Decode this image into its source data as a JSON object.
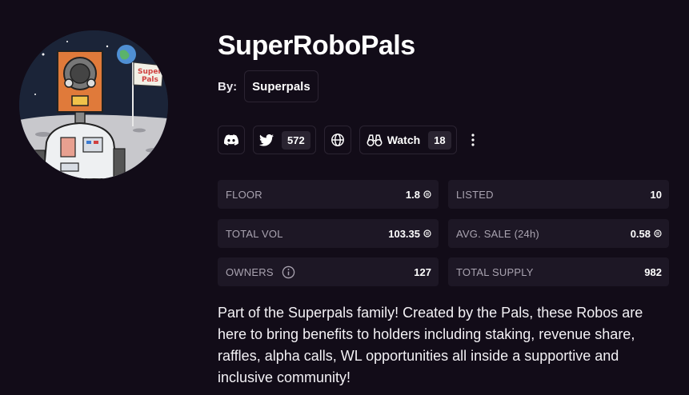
{
  "collection": {
    "name": "SuperRoboPals",
    "by_label": "By:",
    "creator": "Superpals",
    "avatar_flag_text": "Super Pals"
  },
  "social": {
    "discord_icon": "discord-icon",
    "twitter_icon": "twitter-icon",
    "twitter_count": "572",
    "website_icon": "globe-icon",
    "watch_icon": "binoculars-icon",
    "watch_label": "Watch",
    "watch_count": "18",
    "more_icon": "kebab-menu-icon"
  },
  "stats": {
    "floor": {
      "label": "FLOOR",
      "value": "1.8"
    },
    "listed": {
      "label": "LISTED",
      "value": "10"
    },
    "total_vol": {
      "label": "TOTAL VOL",
      "value": "103.35"
    },
    "avg_sale": {
      "label": "AVG. SALE (24h)",
      "value": "0.58"
    },
    "owners": {
      "label": "OWNERS",
      "value": "127"
    },
    "total_supply": {
      "label": "TOTAL SUPPLY",
      "value": "982"
    }
  },
  "description": "Part of the Superpals family! Created by the Pals, these Robos are here to bring benefits to holders including staking, revenue share, raffles, alpha calls, WL opportunities all inside a supportive and inclusive community!",
  "colors": {
    "background": "#120c18",
    "card": "#1d1725",
    "border": "#2b2432",
    "muted": "#a9a3b0"
  }
}
